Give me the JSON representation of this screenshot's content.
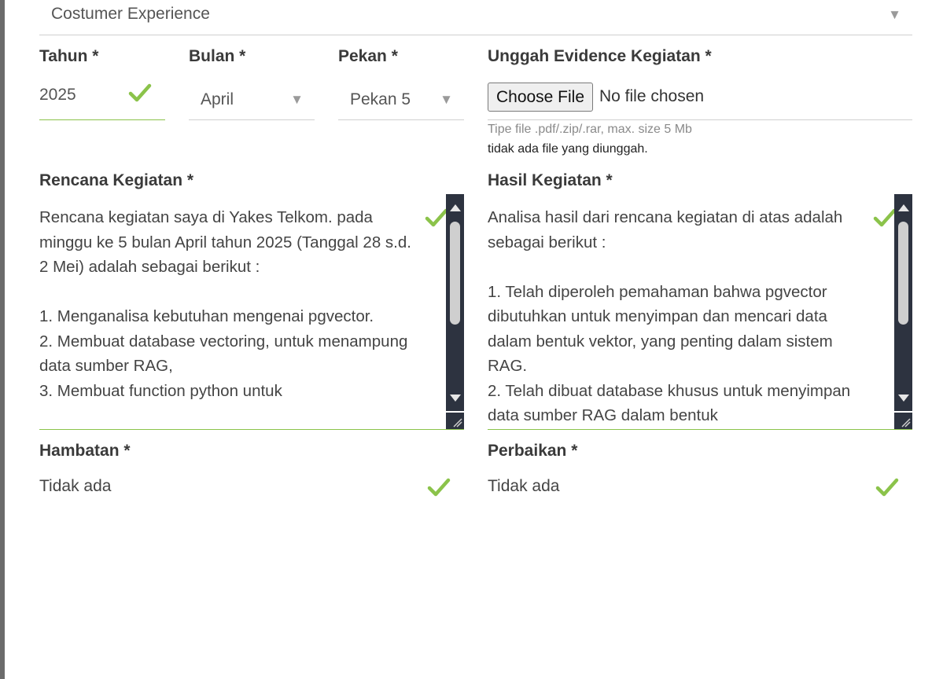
{
  "top_select": {
    "value": "Costumer Experience"
  },
  "tahun": {
    "label": "Tahun *",
    "value": "2025"
  },
  "bulan": {
    "label": "Bulan *",
    "value": "April"
  },
  "pekan": {
    "label": "Pekan *",
    "value": "Pekan 5"
  },
  "evidence": {
    "label": "Unggah Evidence Kegiatan *",
    "button": "Choose File",
    "status": "No file chosen",
    "hint": "Tipe file .pdf/.zip/.rar, max. size 5 Mb",
    "uploaded": "tidak ada file yang diunggah."
  },
  "rencana": {
    "label": "Rencana Kegiatan *",
    "text": "Rencana kegiatan saya di Yakes Telkom. pada minggu ke 5 bulan April tahun 2025 (Tanggal 28 s.d. 2 Mei) adalah sebagai berikut :\n\n1. Menganalisa kebutuhan mengenai pgvector.\n2. Membuat database vectoring, untuk menampung data sumber RAG,\n3. Membuat function python untuk"
  },
  "hasil": {
    "label": "Hasil Kegiatan *",
    "text": "Analisa hasil dari rencana kegiatan di atas adalah sebagai berikut :\n\n1. Telah diperoleh pemahaman bahwa pgvector dibutuhkan untuk menyimpan dan mencari data dalam bentuk vektor, yang penting dalam sistem RAG.\n2. Telah dibuat database khusus untuk menyimpan data sumber RAG dalam bentuk"
  },
  "hambatan": {
    "label": "Hambatan *",
    "value": "Tidak ada"
  },
  "perbaikan": {
    "label": "Perbaikan *",
    "value": "Tidak ada"
  },
  "colors": {
    "valid": "#8bc34a",
    "scrollbar": "#2d3340"
  },
  "icons": {
    "valid": "check-icon",
    "dropdown": "caret-down-icon"
  }
}
